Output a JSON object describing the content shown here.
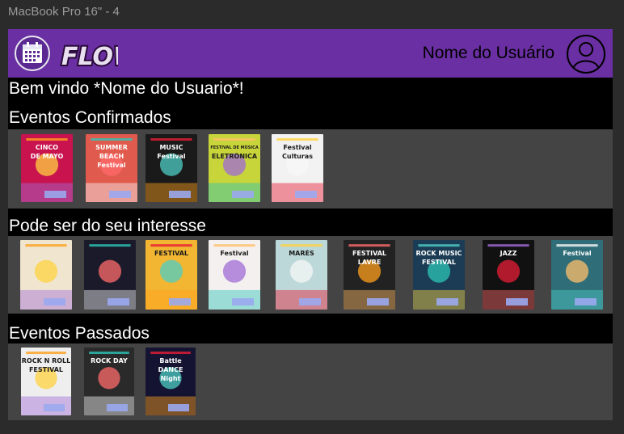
{
  "window": {
    "title": "MacBook Pro 16\" - 4"
  },
  "header": {
    "logo_text": "FLOW",
    "user_name": "Nome do Usuário",
    "calendar_icon": "calendar-icon",
    "avatar_icon": "user-circle-icon"
  },
  "welcome": "Bem vindo *Nome do Usuario*!",
  "sections": {
    "confirmed": {
      "title": "Eventos Confirmados",
      "posters": [
        {
          "name": "cinco-de-mayo",
          "lines": [
            "CINCO",
            "DE MAYO"
          ],
          "bg": "#c8134f"
        },
        {
          "name": "summer-beach",
          "lines": [
            "SUMMER",
            "BEACH",
            "Festival"
          ],
          "bg": "#e05a4e"
        },
        {
          "name": "music-festival-guitar",
          "lines": [
            "MUSIC",
            "Festival"
          ],
          "bg": "#1a1a1a"
        },
        {
          "name": "festival-eletronica",
          "lines": [
            "FESTIVAL DE MÚSICA",
            "ELETRÔNICA"
          ],
          "bg": "#c7d43a"
        },
        {
          "name": "festival-culturas",
          "lines": [
            "Festival",
            "Culturas"
          ],
          "bg": "#f2f2f2"
        }
      ]
    },
    "interest": {
      "title": "Pode ser do seu interesse",
      "posters": [
        {
          "name": "rock-guitar-poster",
          "lines": [],
          "bg": "#f0e6d0"
        },
        {
          "name": "festival-lineup",
          "lines": [],
          "bg": "#1a1a2a"
        },
        {
          "name": "festival-cinema",
          "lines": [
            "FESTIVAL"
          ],
          "bg": "#f2b632"
        },
        {
          "name": "festival-pink",
          "lines": [
            "Festival"
          ],
          "bg": "#f4f0f0"
        },
        {
          "name": "mares-festival",
          "lines": [
            "MARÉS"
          ],
          "bg": "#bcd8d8"
        },
        {
          "name": "festival-lavre",
          "lines": [
            "FESTIVAL",
            "LAVRE"
          ],
          "bg": "#222"
        },
        {
          "name": "rock-music-festival",
          "lines": [
            "ROCK MUSIC",
            "FESTIVAL"
          ],
          "bg": "#1b3c54"
        },
        {
          "name": "jazz-poster",
          "lines": [
            "JAZZ"
          ],
          "bg": "#111"
        },
        {
          "name": "festival-teal",
          "lines": [
            "Festival"
          ],
          "bg": "#2f6e78"
        }
      ]
    },
    "past": {
      "title": "Eventos Passados",
      "posters": [
        {
          "name": "rock-n-roll-festival",
          "lines": [
            "ROCK N ROLL",
            "FESTIVAL"
          ],
          "bg": "#eeeeee"
        },
        {
          "name": "rock-day",
          "lines": [
            "ROCK DAY"
          ],
          "bg": "#2a2a2a"
        },
        {
          "name": "battle-dance-night",
          "lines": [
            "Battle",
            "DANCE",
            "Night"
          ],
          "bg": "#141432"
        }
      ]
    }
  },
  "colors": {
    "header_bg": "#6a2fa2",
    "row_bg": "#444444",
    "tag": "#9aa9f0"
  }
}
